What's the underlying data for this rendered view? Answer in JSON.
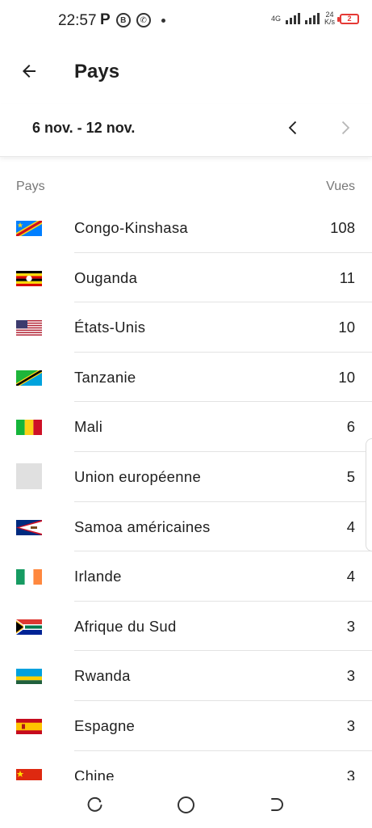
{
  "status_bar": {
    "time": "22:57",
    "p_icon": "P",
    "b_icon": "B",
    "net_type": "4G",
    "speed_value": "24",
    "speed_unit": "K/s",
    "battery": "2"
  },
  "header": {
    "title": "Pays",
    "back_icon": "arrow-left"
  },
  "date_nav": {
    "range": "6 nov. - 12 nov.",
    "prev_icon": "chevron-left",
    "next_icon": "chevron-right"
  },
  "table": {
    "col_country": "Pays",
    "col_views": "Vues",
    "rows": [
      {
        "country": "Congo-Kinshasa",
        "views": "108",
        "flag": "cd"
      },
      {
        "country": "Ouganda",
        "views": "11",
        "flag": "ug"
      },
      {
        "country": "États-Unis",
        "views": "10",
        "flag": "us"
      },
      {
        "country": "Tanzanie",
        "views": "10",
        "flag": "tz"
      },
      {
        "country": "Mali",
        "views": "6",
        "flag": "ml"
      },
      {
        "country": "Union européenne",
        "views": "5",
        "flag": "eu"
      },
      {
        "country": "Samoa américaines",
        "views": "4",
        "flag": "as"
      },
      {
        "country": "Irlande",
        "views": "4",
        "flag": "ie"
      },
      {
        "country": "Afrique du Sud",
        "views": "3",
        "flag": "za"
      },
      {
        "country": "Rwanda",
        "views": "3",
        "flag": "rw"
      },
      {
        "country": "Espagne",
        "views": "3",
        "flag": "es"
      },
      {
        "country": "Chine",
        "views": "3",
        "flag": "cn"
      }
    ]
  }
}
